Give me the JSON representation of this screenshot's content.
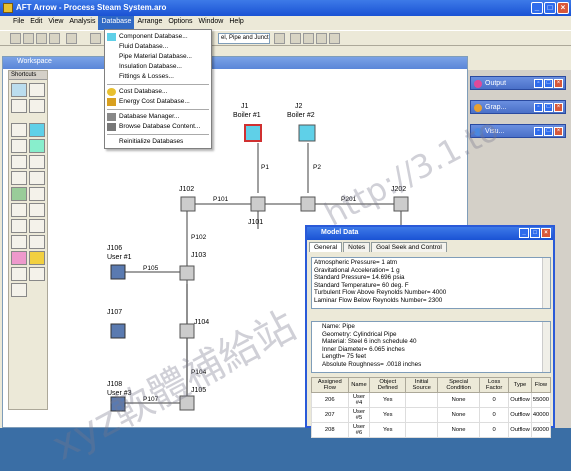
{
  "window": {
    "title": "AFT Arrow - Process Steam System.aro"
  },
  "menubar": [
    {
      "label": "File"
    },
    {
      "label": "Edit"
    },
    {
      "label": "View"
    },
    {
      "label": "Analysis"
    },
    {
      "label": "Database"
    },
    {
      "label": "Arrange"
    },
    {
      "label": "Options"
    },
    {
      "label": "Window"
    },
    {
      "label": "Help"
    }
  ],
  "toolbar": {
    "field_text": "el, Pipe and Junctio"
  },
  "database_menu": {
    "items": [
      "Component Database...",
      "Fluid Database...",
      "Pipe Material Database...",
      "Insulation Database...",
      "Fittings & Losses...",
      "Cost Database...",
      "Energy Cost Database...",
      "Database Manager...",
      "Browse Database Content...",
      "Reinitialize Databases"
    ]
  },
  "workspace": {
    "title": "Workspace",
    "shortcuts_label": "Shortcuts"
  },
  "right_windows": [
    {
      "label": "Output"
    },
    {
      "label": "Grap..."
    },
    {
      "label": "Visu..."
    }
  ],
  "canvas": {
    "junctions": [
      {
        "id": "J1",
        "name": "Boiler #1"
      },
      {
        "id": "J2",
        "name": "Boiler #2"
      },
      {
        "id": "J102",
        "name": ""
      },
      {
        "id": "J101",
        "name": ""
      },
      {
        "id": "J202",
        "name": ""
      },
      {
        "id": "J106",
        "name": "User #1"
      },
      {
        "id": "J103",
        "name": ""
      },
      {
        "id": "J107",
        "name": ""
      },
      {
        "id": "J104",
        "name": ""
      },
      {
        "id": "J108",
        "name": "User #3"
      },
      {
        "id": "J105",
        "name": ""
      }
    ],
    "pipes": [
      "P1",
      "P2",
      "P101",
      "P102",
      "P105",
      "P201",
      "P104",
      "P107"
    ]
  },
  "model_data": {
    "title": "Model Data",
    "tabs": [
      "General",
      "Notes",
      "Goal Seek and Control"
    ],
    "general_lines": [
      "Atmospheric Pressure= 1 atm",
      "Gravitational Acceleration= 1 g",
      "Standard Pressure= 14.696 psia",
      "Standard Temperature= 60 deg. F",
      "Turbulent Flow Above Reynolds Number= 4000",
      "Laminar Flow Below Reynolds Number= 2300"
    ],
    "pipe_lines": [
      "Name: Pipe",
      "Geometry: Cylindrical Pipe",
      "Material: Steel 6 inch schedule 40",
      "Inner Diameter= 6.065 inches",
      "Length= 75 feet",
      "Absolute Roughness= .0018 inches"
    ],
    "table_headers": [
      "Assigned Flow",
      "Name",
      "Object Defined",
      "Initial Source",
      "Special Condition",
      "Loss Factor",
      "Type",
      "Flow"
    ],
    "table_rows": [
      [
        "206",
        "User #4",
        "Yes",
        "",
        "None",
        "0",
        "Outflow",
        "55000"
      ],
      [
        "207",
        "User #5",
        "Yes",
        "",
        "None",
        "0",
        "Outflow",
        "40000"
      ],
      [
        "208",
        "User #6",
        "Yes",
        "",
        "None",
        "0",
        "Outflow",
        "60000"
      ]
    ]
  },
  "watermarks": [
    "xyz軟體補給站",
    "http://3.1.to"
  ]
}
